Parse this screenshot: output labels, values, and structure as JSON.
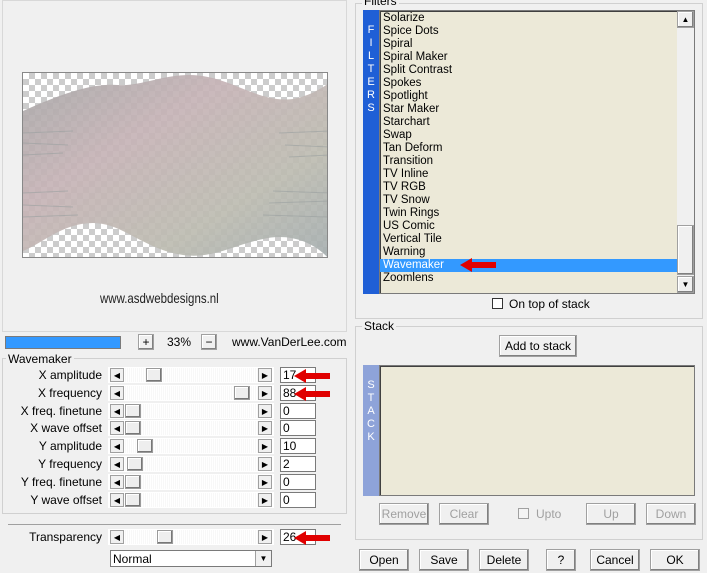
{
  "preview": {
    "watermark": "www.asdwebdesigns.nl",
    "zoom": "33%",
    "zoom_in": "+",
    "zoom_out": "−",
    "site": "www.VanDerLee.com"
  },
  "filters": {
    "title": "Filters",
    "side_label": [
      "F",
      "I",
      "L",
      "T",
      "E",
      "R",
      "S"
    ],
    "items": [
      "Solarize",
      "Spice Dots",
      "Spiral",
      "Spiral Maker",
      "Split Contrast",
      "Spokes",
      "Spotlight",
      "Star Maker",
      "Starchart",
      "Swap",
      "Tan Deform",
      "Transition",
      "TV Inline",
      "TV RGB",
      "TV Snow",
      "Twin Rings",
      "US Comic",
      "Vertical Tile",
      "Warning",
      "Wavemaker",
      "Zoomlens"
    ],
    "selected": "Wavemaker",
    "on_top_label": "On top of stack"
  },
  "stack": {
    "title": "Stack",
    "add_button": "Add to stack",
    "side_label": [
      "S",
      "T",
      "A",
      "C",
      "K"
    ],
    "remove": "Remove",
    "clear": "Clear",
    "upto": "Upto",
    "up": "Up",
    "down": "Down"
  },
  "wavemaker": {
    "title": "Wavemaker",
    "params": [
      {
        "label": "X amplitude",
        "value": "17",
        "fraction": 0.17
      },
      {
        "label": "X frequency",
        "value": "88",
        "fraction": 0.88
      },
      {
        "label": "X freq. finetune",
        "value": "0",
        "fraction": 0.0
      },
      {
        "label": "X wave offset",
        "value": "0",
        "fraction": 0.0
      },
      {
        "label": "Y amplitude",
        "value": "10",
        "fraction": 0.1
      },
      {
        "label": "Y frequency",
        "value": "2",
        "fraction": 0.02
      },
      {
        "label": "Y freq. finetune",
        "value": "0",
        "fraction": 0.0
      },
      {
        "label": "Y wave offset",
        "value": "0",
        "fraction": 0.0
      }
    ],
    "transparency": {
      "label": "Transparency",
      "value": "26",
      "fraction": 0.26
    },
    "blend_mode": "Normal"
  },
  "buttons": {
    "open": "Open",
    "save": "Save",
    "delete": "Delete",
    "help": "?",
    "cancel": "Cancel",
    "ok": "OK"
  },
  "colors": {
    "accent": "#3399ff",
    "filter_bar": "#1f5fd6",
    "stack_bar": "#8ea3d9",
    "arrow": "#e00000"
  }
}
